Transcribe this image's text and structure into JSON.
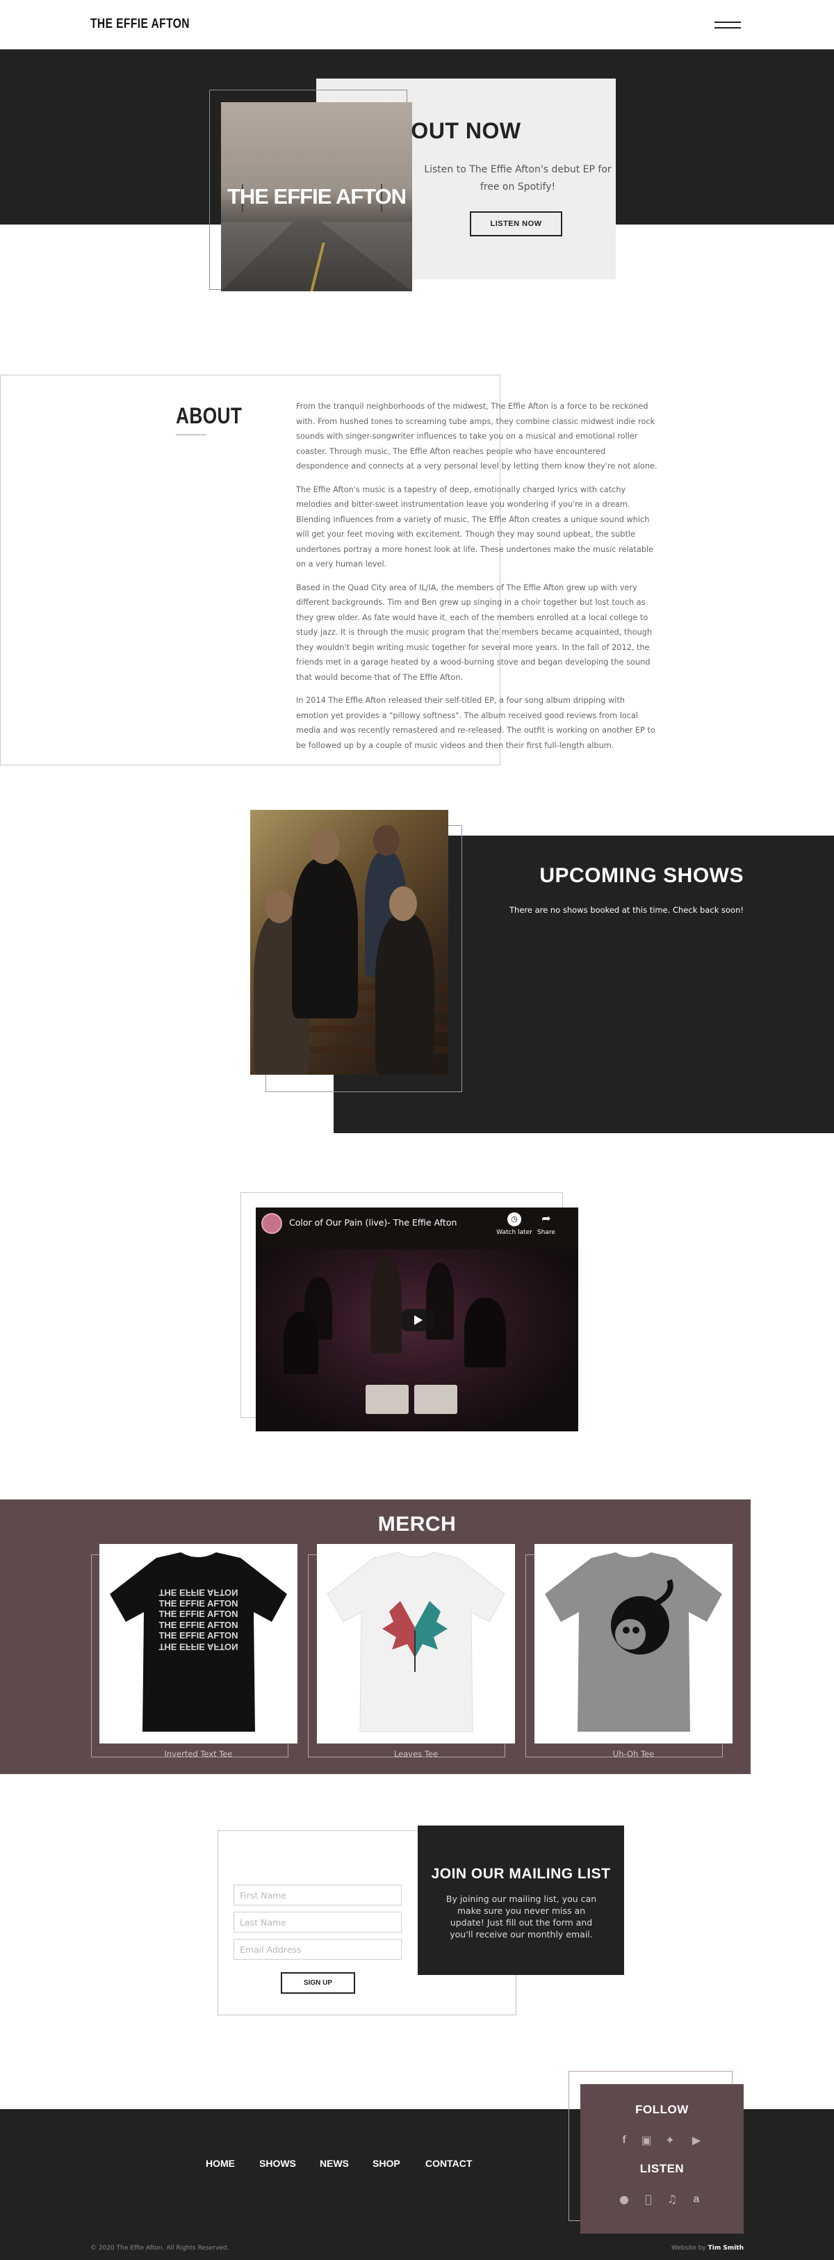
{
  "header": {
    "site_title": "THE EFFIE AFTON",
    "menu_icon": "hamburger-menu-icon"
  },
  "hero": {
    "album_art_text": "THE EFFIE AFTON",
    "title": "OUT NOW",
    "text": "Listen to The Effie Afton's debut EP for free on Spotify!",
    "button_label": "LISTEN NOW"
  },
  "about": {
    "title": "ABOUT",
    "paragraphs": [
      "From the tranquil neighborhoods of the midwest, The Effie Afton is a force to be reckoned with. From hushed tones to screaming tube amps, they combine classic midwest indie rock sounds with singer-songwriter influences to take you on a musical and emotional roller coaster. Through music, The Effie Afton reaches people who have encountered despondence and connects at a very personal level by letting them know they're not alone.",
      "The Effie Afton's music is a tapestry of deep, emotionally charged lyrics with catchy melodies and bitter-sweet instrumentation leave you wondering if you're in a dream. Blending influences from a variety of music, The Effie Afton creates a unique sound which will get your feet moving with excitement. Though they may sound upbeat, the subtle undertones portray a more honest look at life. These undertones make the music relatable on a very human level.",
      "Based in the Quad City area of IL/IA, the members of The Effie Afton grew up with very different backgrounds. Tim and Ben grew up singing in a choir together but lost touch as they grew older. As fate would have it, each of the members enrolled at a local college to study jazz. It is through the music program that the members became acquainted, though they wouldn't begin writing music together for several more years. In the fall of 2012, the friends met in a garage heated by a wood-burning stove and began developing the sound that would become that of The Effie Afton.",
      "In 2014 The Effie Afton released their self-titled EP, a four song album dripping with emotion yet provides a \"pillowy softness\". The album received good reviews from local media and was recently remastered and re-released. The outfit is working on another EP to be followed up by a couple of music videos and then their first full-length album."
    ]
  },
  "shows": {
    "title": "UPCOMING SHOWS",
    "text": "There are no shows booked at this time. Check back soon!"
  },
  "video": {
    "title": "Color of Our Pain (live)- The Effie Afton",
    "watch_later": "Watch later",
    "share": "Share"
  },
  "merch": {
    "title": "MERCH",
    "items": [
      {
        "label": "Inverted Text Tee",
        "shirt_color": "#111111"
      },
      {
        "label": "Leaves Tee",
        "shirt_color": "#f3f3f3"
      },
      {
        "label": "Uh-Oh Tee",
        "shirt_color": "#8c8c8c"
      }
    ],
    "inverted_print_lines": [
      "THE EFFIE AFTON",
      "THE EFFIE AFTON",
      "THE EFFIE AFTON",
      "THE EFFIE AFTON",
      "THE EFFIE AFTON",
      "THE EFFIE AFTON"
    ]
  },
  "mailing": {
    "title": "JOIN OUR MAILING LIST",
    "text": "By joining our mailing list, you can make sure you never miss an update! Just fill out the form and you'll receive our monthly email.",
    "first_name_placeholder": "First Name",
    "last_name_placeholder": "Last Name",
    "email_placeholder": "Email Address",
    "button_label": "SIGN UP"
  },
  "footer": {
    "nav": [
      "HOME",
      "SHOWS",
      "NEWS",
      "SHOP",
      "CONTACT"
    ],
    "follow_title": "FOLLOW",
    "listen_title": "LISTEN",
    "follow_icons": [
      "facebook-icon",
      "instagram-icon",
      "twitter-icon",
      "youtube-icon"
    ],
    "listen_icons": [
      "spotify-icon",
      "apple-icon",
      "music-note-icon",
      "amazon-icon"
    ],
    "copyright": "© 2020 The Effie Afton. All Rights Reserved.",
    "credit_prefix": "Website by",
    "credit_name": "Tim Smith"
  },
  "colors": {
    "dark": "#222222",
    "mauve": "#5e4a4c",
    "hero_card": "#f0eeec"
  }
}
